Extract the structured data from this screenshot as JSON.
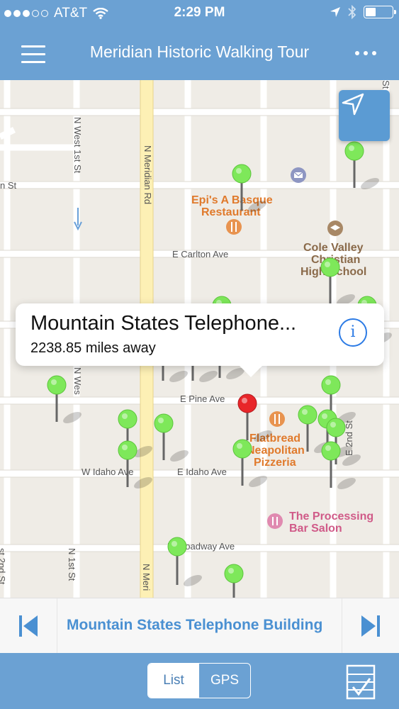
{
  "status": {
    "carrier": "AT&T",
    "time": "2:29 PM",
    "signal_dots_filled": 3,
    "signal_dots_total": 5
  },
  "nav": {
    "title": "Meridian Historic Walking Tour",
    "menu_icon": "hamburger-icon",
    "more_icon": "more-dots-icon"
  },
  "map": {
    "streets": {
      "n_meridian_rd": "N Meridian Rd",
      "n_west_1st_st": "N West 1st St",
      "st_left_edge": "n St",
      "e_carlton_ave": "E Carlton Ave",
      "e_pine_ave": "E Pine Ave",
      "w_idaho_ave": "W Idaho Ave",
      "e_idaho_ave": "E Idaho Ave",
      "e_broadway_ave": "E Broadway Ave",
      "n_west_left": "N Wes",
      "n_1st_st": "N 1st St",
      "n_meri_bottom": "N Meri",
      "st_2nd_left": "st 2nd St",
      "e_2nd_st": "E 2nd St",
      "top_right": "St"
    },
    "pois": [
      {
        "name_line1": "Epi's A Basque",
        "name_line2": "Restaurant",
        "icon": "fork-knife-icon"
      },
      {
        "name_line1": "Cole Valley",
        "name_line2": "Christian",
        "name_line3": "High School",
        "icon": "graduation-cap-icon"
      },
      {
        "name_line1": "Flatbread",
        "name_line2": "Neapolitan",
        "name_line3": "Pizzeria",
        "icon": "fork-knife-icon"
      },
      {
        "name_line1": "The Processing",
        "name_line2": "Bar Salon",
        "icon": "scissors-icon"
      }
    ],
    "colors": {
      "pin_default": "#7ee85a",
      "pin_selected": "#e8262a",
      "poi_food": "#e07a2c",
      "poi_school": "#8a6a4a",
      "poi_salon": "#d05a88"
    }
  },
  "callout": {
    "title": "Mountain States Telephone...",
    "distance": "2238.85 miles away",
    "info_glyph": "i"
  },
  "carousel": {
    "current_label": "Mountain States Telephone Building"
  },
  "tabbar": {
    "list_label": "List",
    "gps_label": "GPS",
    "selected": "List"
  }
}
